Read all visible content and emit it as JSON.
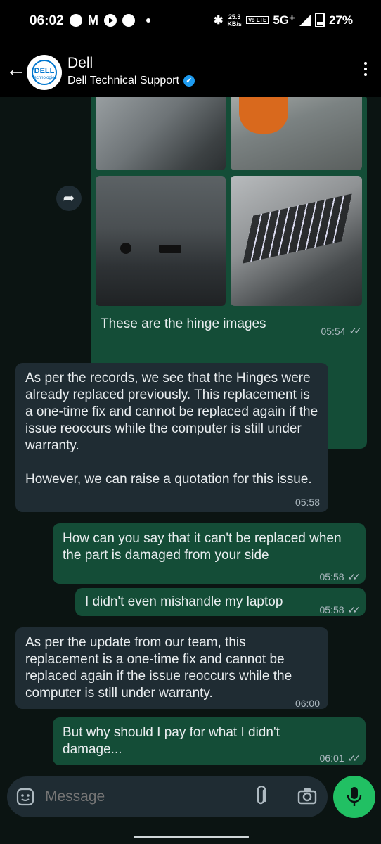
{
  "status_bar": {
    "time": "06:02",
    "m_icon": "M",
    "speed_value": "25.3",
    "speed_unit": "KB/s",
    "volte": "Vo LTE",
    "network": "5G⁺",
    "battery": "27%"
  },
  "header": {
    "back_icon": "←",
    "logo_text": "DELL",
    "logo_subtext": "Technologies",
    "name": "Dell",
    "subtitle": "Dell Technical Support",
    "verified_mark": "✓"
  },
  "messages": [
    {
      "direction": "out",
      "type": "images",
      "caption": "These are the hinge images",
      "time": "05:54"
    },
    {
      "direction": "in",
      "type": "text",
      "text": "As per the records, we see that the Hinges were already replaced previously. This replacement is a one-time fix and cannot be replaced again if the issue reoccurs while the computer is still under warranty.\n\nHowever, we can raise a quotation for this issue.",
      "time": "05:58"
    },
    {
      "direction": "out",
      "type": "text",
      "text": "How can you say that it can't be replaced when the part is damaged from your side",
      "time": "05:58"
    },
    {
      "direction": "out",
      "type": "text",
      "text": "I didn't even mishandle my laptop",
      "time": "05:58"
    },
    {
      "direction": "in",
      "type": "text",
      "text": "As per the update from our team, this replacement is a one-time fix and cannot be replaced again if the issue reoccurs while the computer is still under warranty.",
      "time": "06:00"
    },
    {
      "direction": "out",
      "type": "text",
      "text": "But why should I pay for what I didn't damage...",
      "time": "06:01"
    }
  ],
  "forward_icon": "➦",
  "ticks": "✓✓",
  "composer": {
    "placeholder": "Message",
    "emoji_icon": "sticker-icon",
    "attach_icon": "paperclip-icon",
    "camera_icon": "camera-icon",
    "mic_icon": "mic-icon"
  },
  "colors": {
    "outgoing_bubble": "#144d37",
    "incoming_bubble": "#1f2c33",
    "mic_button": "#21c063",
    "verified": "#1d9bf0"
  }
}
